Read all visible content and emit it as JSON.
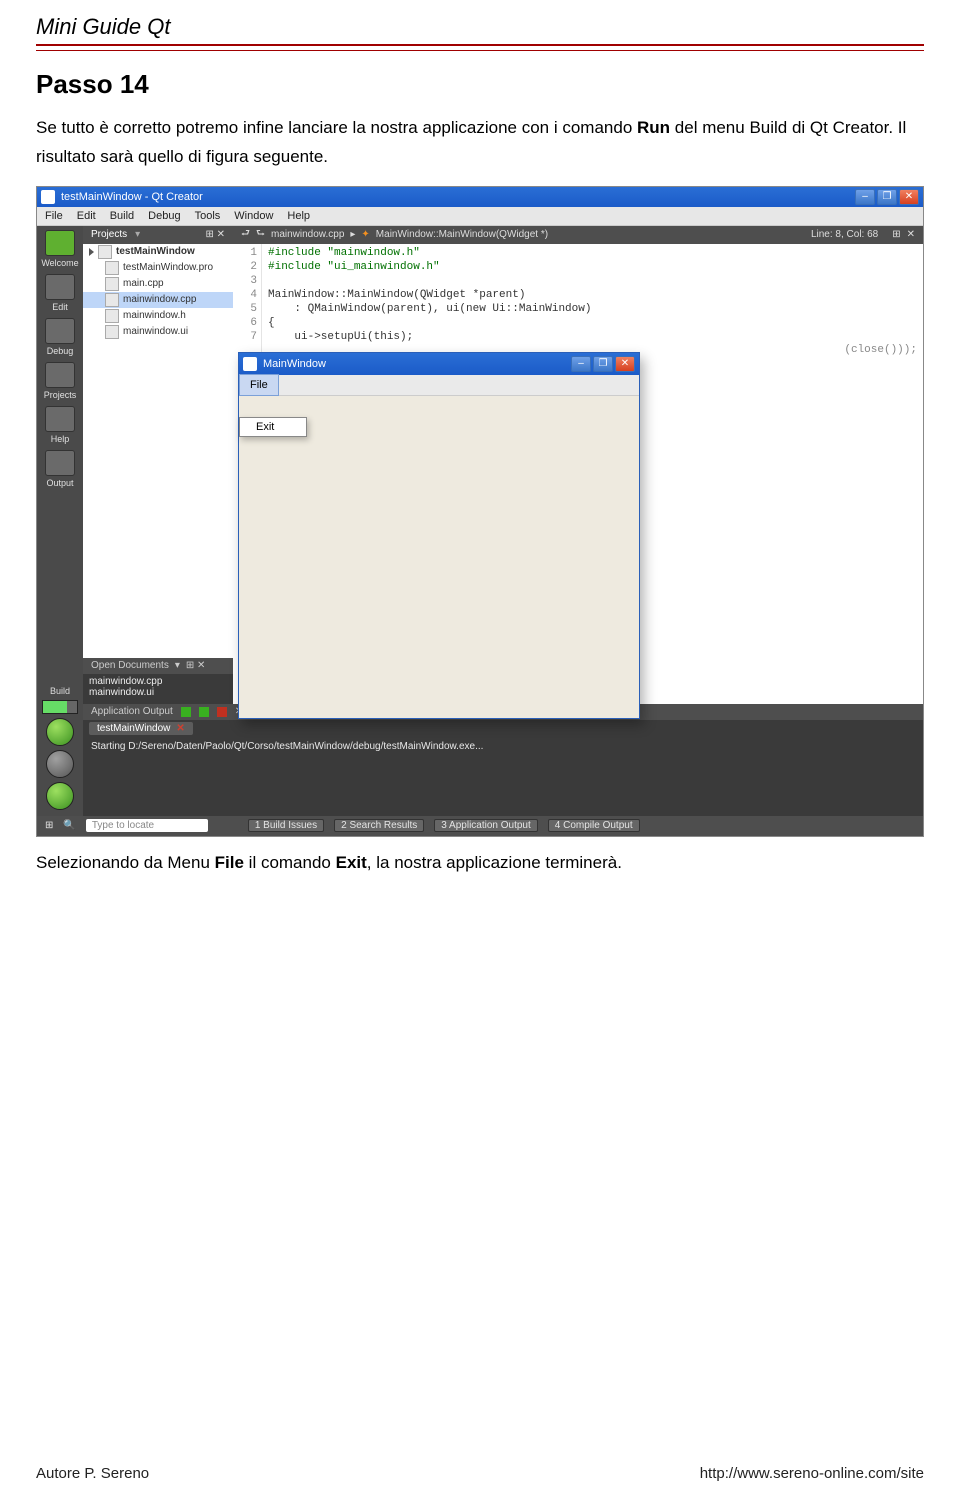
{
  "doc": {
    "header_title": "Mini Guide Qt",
    "heading": "Passo 14",
    "p1_a": "Se tutto è corretto potremo infine lanciare la nostra applicazione con i comando ",
    "p1_b": "Run",
    "p1_c": " del menu Build di Qt Creator. Il risultato sarà quello di figura seguente.",
    "p2_a": "Selezionando  da Menu ",
    "p2_b": "File",
    "p2_c": " il comando ",
    "p2_d": "Exit",
    "p2_e": ", la nostra applicazione terminerà.",
    "footer_left": "Autore P. Sereno",
    "footer_right": "http://www.sereno-online.com/site"
  },
  "ide": {
    "window_title": "testMainWindow - Qt Creator",
    "menus": [
      "File",
      "Edit",
      "Build",
      "Debug",
      "Tools",
      "Window",
      "Help"
    ],
    "side": [
      {
        "label": "Welcome",
        "icon": "qt"
      },
      {
        "label": "Edit",
        "icon": ""
      },
      {
        "label": "Debug",
        "icon": ""
      },
      {
        "label": "Projects",
        "icon": ""
      },
      {
        "label": "Help",
        "icon": ""
      },
      {
        "label": "Output",
        "icon": ""
      }
    ],
    "side_build_label": "Build",
    "projects_label": "Projects",
    "project_tree": {
      "root": "testMainWindow",
      "files": [
        "testMainWindow.pro",
        "main.cpp",
        "mainwindow.cpp",
        "mainwindow.h",
        "mainwindow.ui"
      ],
      "selected_index": 2
    },
    "editor": {
      "crumb_file": "mainwindow.cpp",
      "crumb_symbol": "MainWindow::MainWindow(QWidget *)",
      "status": "Line: 8, Col: 68",
      "lines": [
        "#include \"mainwindow.h\"",
        "#include \"ui_mainwindow.h\"",
        "",
        "MainWindow::MainWindow(QWidget *parent)",
        "    : QMainWindow(parent), ui(new Ui::MainWindow)",
        "{",
        "    ui->setupUi(this);"
      ],
      "right_fragment": "(close()));"
    },
    "open_docs": {
      "label": "Open Documents",
      "items": [
        "mainwindow.cpp",
        "mainwindow.ui"
      ]
    },
    "app_output": {
      "label": "Application Output",
      "tab": "testMainWindow",
      "line": "Starting D:/Sereno/Daten/Paolo/Qt/Corso/testMainWindow/debug/testMainWindow.exe..."
    },
    "bottom": {
      "search_placeholder": "Type to locate",
      "buttons": [
        "1  Build Issues",
        "2  Search Results",
        "3  Application Output",
        "4  Compile Output"
      ]
    }
  },
  "app": {
    "title": "MainWindow",
    "menu": "File",
    "menu_item": "Exit"
  }
}
